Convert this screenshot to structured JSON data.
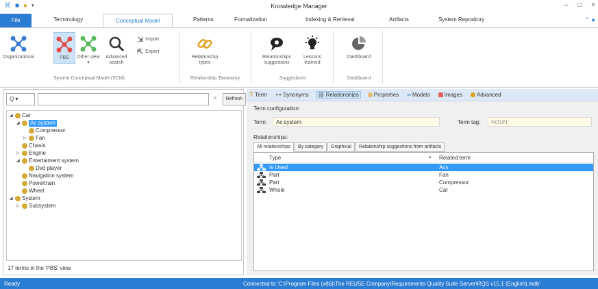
{
  "window": {
    "title": "Knowledge Manager",
    "controls": [
      "–",
      "□",
      "×"
    ]
  },
  "ribbon_tabs": [
    {
      "label": "File"
    },
    {
      "label": "Terminology"
    },
    {
      "label": "Conceptual Model"
    },
    {
      "label": "Patterns"
    },
    {
      "label": "Formalization"
    },
    {
      "label": "Indexing & Retrieval"
    },
    {
      "label": "Artifacts"
    },
    {
      "label": "System Repository"
    }
  ],
  "ribbon": {
    "organizational": "Organizational",
    "pbs": "PBS",
    "other_view": "Other view ▾",
    "advanced_search": "Advanced search",
    "import": "Import",
    "export": "Export",
    "relationship_types": "Relationship types",
    "relationships_suggestions": "Relationships suggestions",
    "lessons_learned": "Lessons learned",
    "dashboard": "Dashboard",
    "groups": {
      "scm": "System Conceptual Model (SCM)",
      "taxonomy": "Relationship Taxonomy",
      "suggestions": "Suggestions",
      "dashboard": "Dashboard"
    }
  },
  "left_pane": {
    "search_dropdown": "Q ▾",
    "search_placeholder": "",
    "clear": "×",
    "refresh": "Refresh",
    "tree": [
      {
        "label": "Car",
        "arrow": "◢"
      },
      {
        "label": "Ac system",
        "arrow": "◢"
      },
      {
        "label": "Compressor",
        "arrow": ""
      },
      {
        "label": "Fan",
        "arrow": "▷"
      },
      {
        "label": "Chasis",
        "arrow": ""
      },
      {
        "label": "Engine",
        "arrow": "▷"
      },
      {
        "label": "Entertaiment system",
        "arrow": "◢"
      },
      {
        "label": "Dvd player",
        "arrow": ""
      },
      {
        "label": "Navigation system",
        "arrow": ""
      },
      {
        "label": "Powertrain",
        "arrow": ""
      },
      {
        "label": "Wheel",
        "arrow": ""
      },
      {
        "label": "System",
        "arrow": "◢"
      },
      {
        "label": "Subsystem",
        "arrow": "▷"
      }
    ],
    "status": "17 terms in the 'PBS' view"
  },
  "right_pane": {
    "tabs": [
      {
        "label": "Term"
      },
      {
        "label": "Synonyms"
      },
      {
        "label": "Relationships"
      },
      {
        "label": "Properties"
      },
      {
        "label": "Models"
      },
      {
        "label": "Images"
      },
      {
        "label": "Advanced"
      }
    ],
    "term_configuration_label": "Term configuration:",
    "term_label": "Term:",
    "term_value": "Ac system",
    "term_tag_label": "Term tag:",
    "term_tag_value": "NOUN",
    "relationships_label": "Relationships:",
    "subtabs": [
      {
        "label": "All relationships"
      },
      {
        "label": "By category"
      },
      {
        "label": "Graphical"
      },
      {
        "label": "Relationship suggestions from artifacts"
      }
    ],
    "columns": {
      "type": "Type",
      "related": "Related term",
      "sort": "▲"
    },
    "rows": [
      {
        "type": "Is Used",
        "related": "Acs"
      },
      {
        "type": "Part",
        "related": "Fan"
      },
      {
        "type": "Part",
        "related": "Compressor"
      },
      {
        "type": "Whole",
        "related": "Car"
      }
    ]
  },
  "statusbar": {
    "left": "Ready",
    "right": "Connected to 'C:\\Program Files (x86)\\The REUSE Company\\Requirements Quality Suite Server\\RQS v15.1 (English).mdb'"
  },
  "colors": {
    "accent": "#2b7cd3",
    "selection": "#3399ff",
    "node": "#d4a935"
  }
}
